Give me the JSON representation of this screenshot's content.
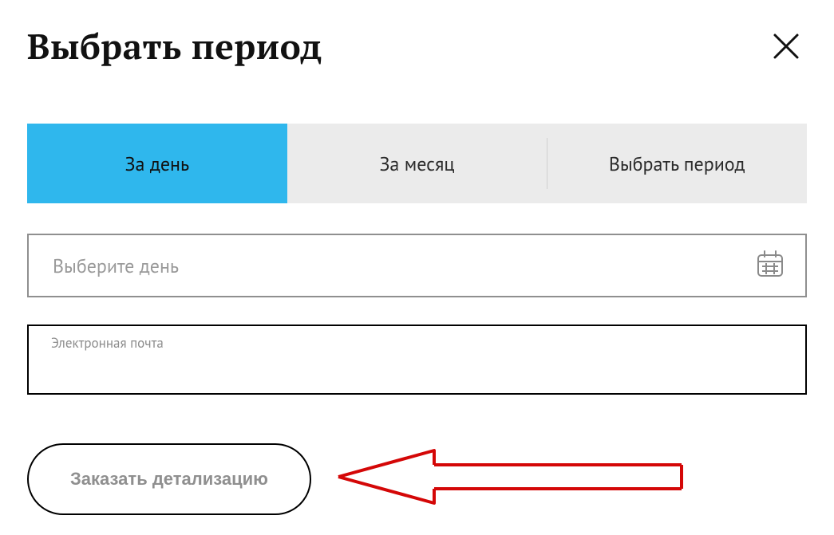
{
  "title": "Выбрать период",
  "tabs": {
    "day": {
      "label": "За день"
    },
    "month": {
      "label": "За месяц"
    },
    "custom": {
      "label": "Выбрать период"
    }
  },
  "date_field": {
    "placeholder": "Выберите день"
  },
  "email_field": {
    "label": "Электронная почта",
    "value": ""
  },
  "order_button": {
    "label": "Заказать детализацию"
  },
  "colors": {
    "accent": "#2fb7ed",
    "annotation": "#d40707"
  }
}
